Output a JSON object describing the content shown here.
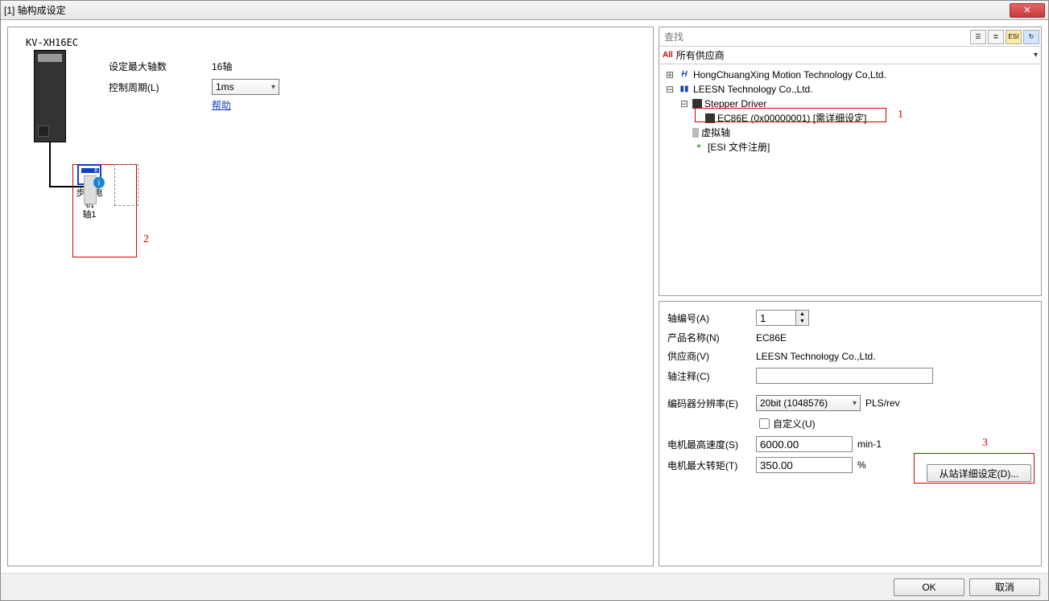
{
  "window": {
    "title": "[1] 轴构成设定"
  },
  "left": {
    "device_label": "KV-XH16EC",
    "max_axes_label": "设定最大轴数",
    "max_axes_value": "16轴",
    "cycle_label": "控制周期(L)",
    "cycle_value": "1ms",
    "help": "帮助",
    "axis1_line1": "步进电机",
    "axis1_line2": "轴1",
    "annot2": "2"
  },
  "tree": {
    "search_placeholder": "查找",
    "all_label": "所有供应商",
    "vendor1": "HongChuangXing Motion Technology Co,Ltd.",
    "vendor2": "LEESN Technology Co.,Ltd.",
    "cat": "Stepper Driver",
    "device": "EC86E (0x00000001) [需详细设定]",
    "virtual": "虚拟轴",
    "esi": "[ESI 文件注册]",
    "annot1": "1"
  },
  "form": {
    "axis_no_label": "轴编号(A)",
    "axis_no_value": "1",
    "prod_name_label": "产品名称(N)",
    "prod_name_value": "EC86E",
    "vendor_label": "供应商(V)",
    "vendor_value": "LEESN Technology Co.,Ltd.",
    "comment_label": "轴注释(C)",
    "comment_value": "",
    "encoder_label": "编码器分辨率(E)",
    "encoder_value": "20bit (1048576)",
    "encoder_unit": "PLS/rev",
    "custom_label": "自定义(U)",
    "max_speed_label": "电机最高速度(S)",
    "max_speed_value": "6000.00",
    "max_speed_unit": "min-1",
    "max_torque_label": "电机最大转矩(T)",
    "max_torque_value": "350.00",
    "max_torque_unit": "%",
    "detail_btn": "从站详细设定(D)...",
    "annot3": "3"
  },
  "footer": {
    "ok": "OK",
    "cancel": "取消"
  }
}
